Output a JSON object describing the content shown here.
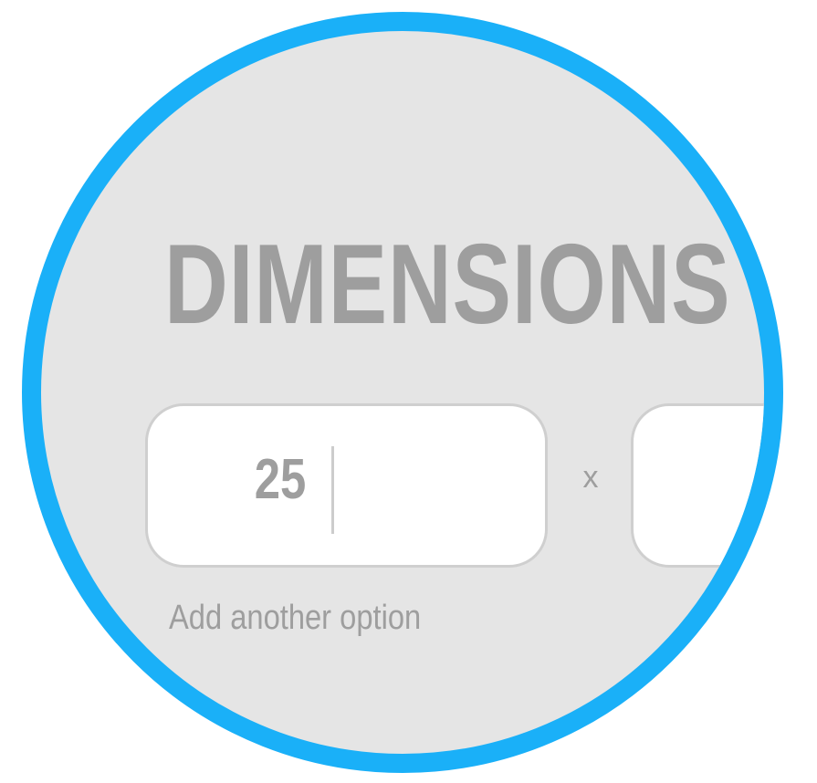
{
  "section": {
    "title": "DIMENSIONS"
  },
  "dimensions": {
    "width_value": "25",
    "height_value": "",
    "separator": "x"
  },
  "actions": {
    "add_option_label": "Add another option"
  },
  "colors": {
    "ring": "#1ab0f8",
    "background": "#e5e5e5",
    "text": "#9e9e9e",
    "field_border": "#cfcfcf",
    "field_background": "#ffffff"
  }
}
